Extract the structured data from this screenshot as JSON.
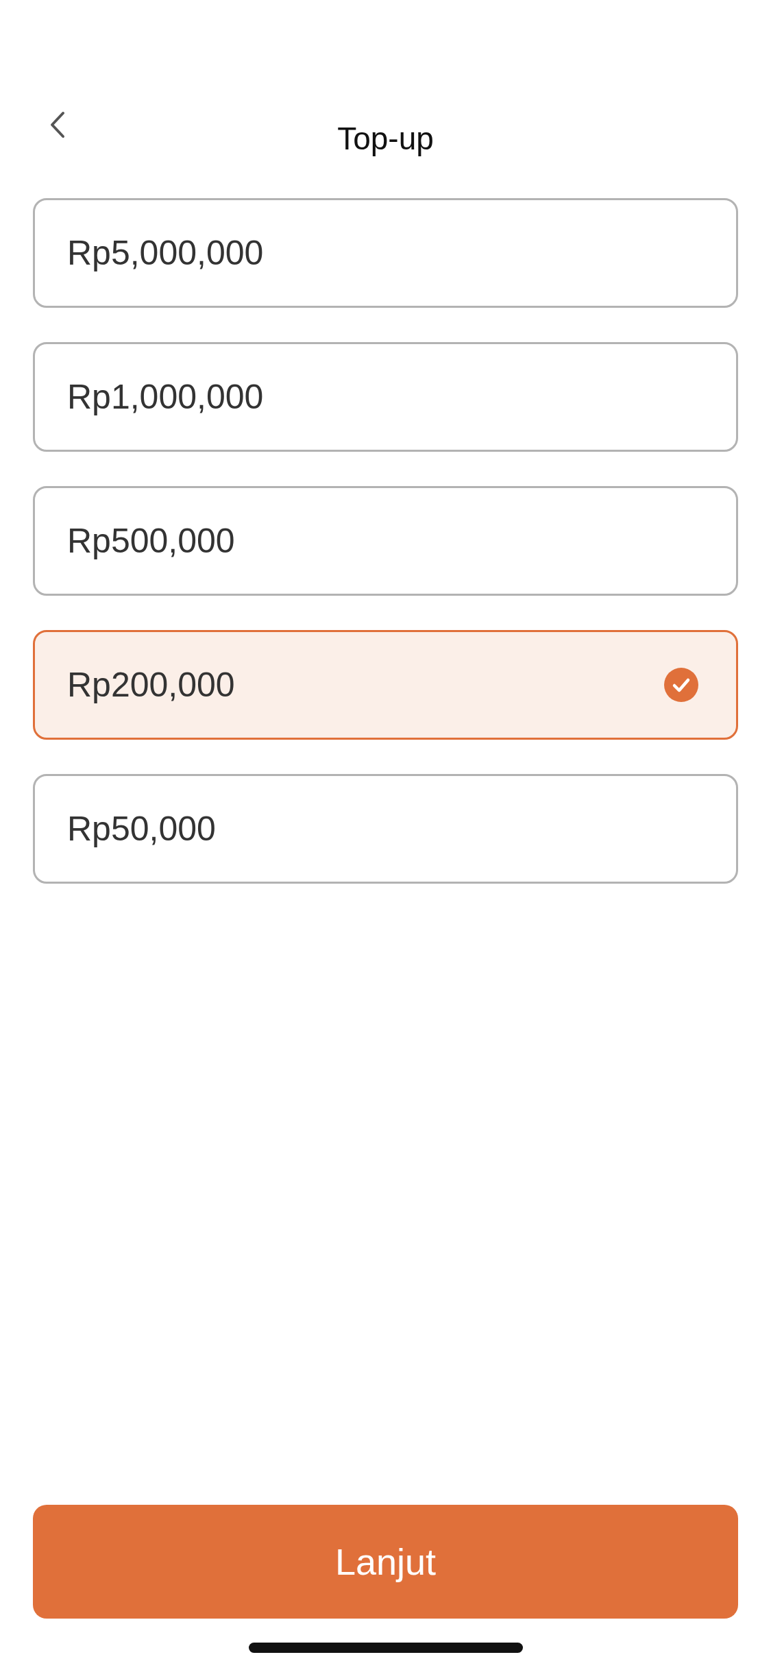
{
  "header": {
    "title": "Top-up"
  },
  "options": [
    {
      "label": "Rp5,000,000",
      "selected": false
    },
    {
      "label": "Rp1,000,000",
      "selected": false
    },
    {
      "label": "Rp500,000",
      "selected": false
    },
    {
      "label": "Rp200,000",
      "selected": true
    },
    {
      "label": "Rp50,000",
      "selected": false
    }
  ],
  "continue_button": {
    "label": "Lanjut"
  }
}
